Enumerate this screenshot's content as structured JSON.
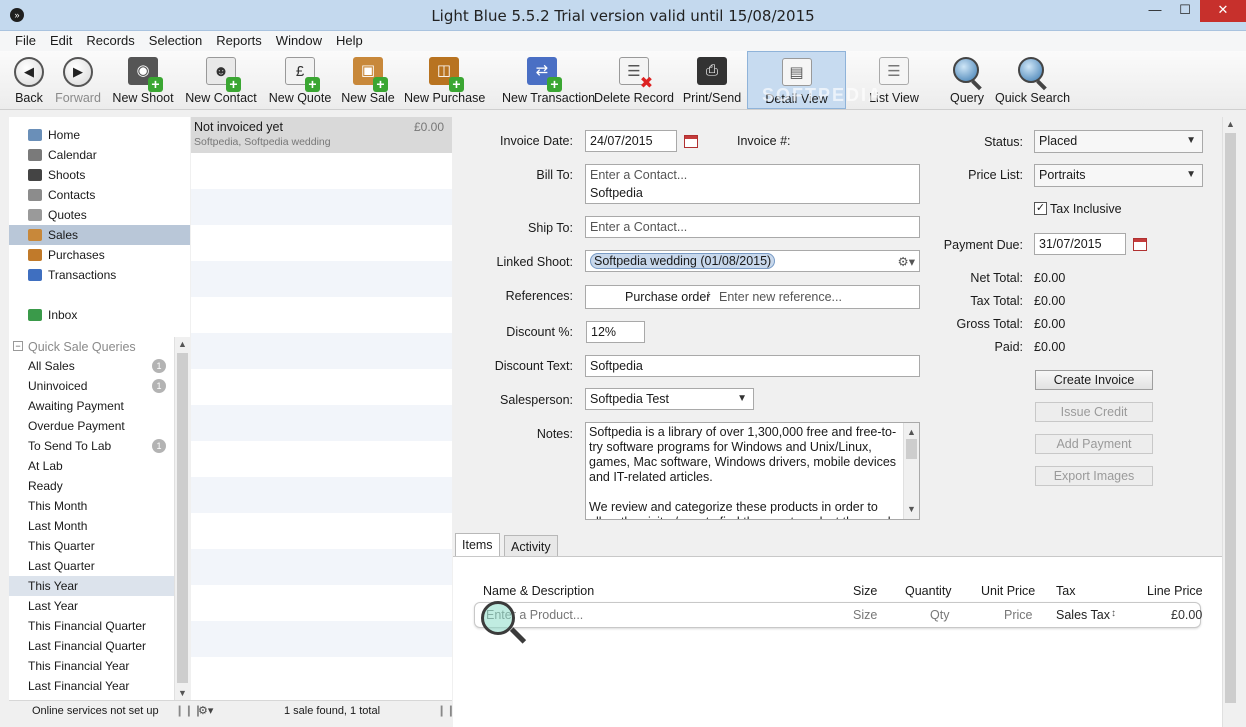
{
  "window": {
    "title": "Light Blue 5.5.2    Trial version valid until 15/08/2015",
    "minimize": "—",
    "maximize": "☐",
    "close": "✕"
  },
  "menu": [
    "File",
    "Edit",
    "Records",
    "Selection",
    "Reports",
    "Window",
    "Help"
  ],
  "toolbar": {
    "back": "Back",
    "forward": "Forward",
    "new_shoot": "New Shoot",
    "new_contact": "New Contact",
    "new_quote": "New Quote",
    "new_sale": "New Sale",
    "new_purchase": "New Purchase",
    "new_transaction": "New Transaction",
    "delete_record": "Delete Record",
    "print_send": "Print/Send",
    "detail_view": "Detail View",
    "list_view": "List View",
    "query": "Query",
    "quick_search": "Quick Search"
  },
  "nav": [
    {
      "label": "Home",
      "icon": "home-icon",
      "color": "#6a8fb8"
    },
    {
      "label": "Calendar",
      "icon": "calendar-icon",
      "color": "#7a7a7a"
    },
    {
      "label": "Shoots",
      "icon": "camera-icon",
      "color": "#444444"
    },
    {
      "label": "Contacts",
      "icon": "contacts-icon",
      "color": "#8c8c8c"
    },
    {
      "label": "Quotes",
      "icon": "quotes-icon",
      "color": "#9a9a9a"
    },
    {
      "label": "Sales",
      "icon": "sales-icon",
      "color": "#c8883a"
    },
    {
      "label": "Purchases",
      "icon": "purchases-icon",
      "color": "#c17a2a"
    },
    {
      "label": "Transactions",
      "icon": "transactions-icon",
      "color": "#3f6fc0"
    }
  ],
  "inbox": {
    "label": "Inbox"
  },
  "quick_queries": {
    "title": "Quick Sale Queries",
    "items": [
      {
        "label": "All Sales",
        "badge": "1"
      },
      {
        "label": "Uninvoiced",
        "badge": "1"
      },
      {
        "label": "Awaiting Payment",
        "badge": ""
      },
      {
        "label": "Overdue Payment",
        "badge": ""
      },
      {
        "label": "To Send To Lab",
        "badge": "1"
      },
      {
        "label": "At Lab",
        "badge": ""
      },
      {
        "label": "Ready",
        "badge": ""
      },
      {
        "label": "This Month",
        "badge": ""
      },
      {
        "label": "Last Month",
        "badge": ""
      },
      {
        "label": "This Quarter",
        "badge": ""
      },
      {
        "label": "Last Quarter",
        "badge": ""
      },
      {
        "label": "This Year",
        "badge": ""
      },
      {
        "label": "Last Year",
        "badge": ""
      },
      {
        "label": "This Financial Quarter",
        "badge": ""
      },
      {
        "label": "Last Financial Quarter",
        "badge": ""
      },
      {
        "label": "This Financial Year",
        "badge": ""
      },
      {
        "label": "Last Financial Year",
        "badge": ""
      }
    ]
  },
  "status": {
    "online": "Online services not set up",
    "found": "1 sale found, 1 total"
  },
  "list": {
    "row_title": "Not invoiced yet",
    "row_amount": "£0.00",
    "row_subtitle": "Softpedia, Softpedia wedding"
  },
  "form": {
    "invoice_date_label": "Invoice Date:",
    "invoice_date": "24/07/2015",
    "invoice_no_label": "Invoice #:",
    "bill_to_label": "Bill To:",
    "bill_to_placeholder": "Enter a Contact...",
    "bill_to_value": "Softpedia",
    "ship_to_label": "Ship To:",
    "ship_to_placeholder": "Enter a Contact...",
    "linked_shoot_label": "Linked Shoot:",
    "linked_shoot": "Softpedia wedding (01/08/2015)",
    "references_label": "References:",
    "ref_type": "Purchase order",
    "ref_placeholder": "Enter new reference...",
    "discount_pct_label": "Discount %:",
    "discount_pct": "12%",
    "discount_text_label": "Discount Text:",
    "discount_text": "Softpedia",
    "salesperson_label": "Salesperson:",
    "salesperson": "Softpedia Test",
    "notes_label": "Notes:",
    "notes_p1": "Softpedia is a library of over 1,300,000 free and free-to-try software programs for Windows and Unix/Linux, games, Mac software, Windows drivers, mobile devices and IT-related articles.",
    "notes_p2": "We review and categorize these products in order to allow the visitor/user to find the exact product they and their"
  },
  "right": {
    "status_label": "Status:",
    "status": "Placed",
    "price_list_label": "Price List:",
    "price_list": "Portraits",
    "tax_inclusive": "Tax Inclusive",
    "payment_due_label": "Payment Due:",
    "payment_due": "31/07/2015",
    "net_total_label": "Net Total:",
    "net_total": "£0.00",
    "tax_total_label": "Tax Total:",
    "tax_total": "£0.00",
    "gross_total_label": "Gross Total:",
    "gross_total": "£0.00",
    "paid_label": "Paid:",
    "paid": "£0.00",
    "create_invoice": "Create Invoice",
    "issue_credit": "Issue Credit",
    "add_payment": "Add Payment",
    "export_images": "Export Images"
  },
  "tabs": [
    "Items",
    "Activity"
  ],
  "items_table": {
    "headers": [
      "Name & Description",
      "Size",
      "Quantity",
      "Unit Price",
      "Tax",
      "Line Price"
    ],
    "entry": {
      "product_placeholder": "Enter a Product...",
      "size": "Size",
      "qty": "Qty",
      "price": "Price",
      "tax": "Sales Tax",
      "line": "£0.00"
    }
  },
  "watermark": "SOFTPEDIA"
}
